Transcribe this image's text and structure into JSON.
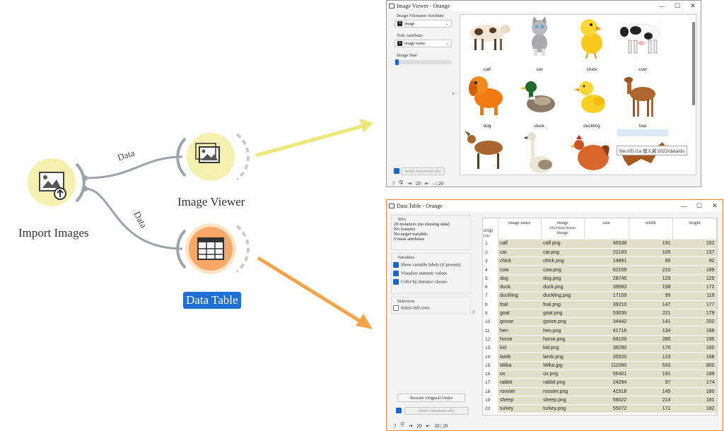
{
  "workflow": {
    "nodes": {
      "import_images": "Import Images",
      "image_viewer": "Image Viewer",
      "data_table": "Data Table"
    },
    "edges": {
      "top": "Data",
      "bottom": "Data"
    },
    "colors": {
      "node_fill": "#f4f0b0",
      "table_fill": "#f9a766",
      "edge": "#9aa4ac",
      "arrow_yellow": "#ece87a",
      "arrow_orange": "#f5a44a",
      "selected_label_bg": "#1f6fd6"
    }
  },
  "image_viewer": {
    "title": "Image Viewer - Orange",
    "filename_attr_label": "Image Filename Attribute",
    "filename_attr_value": "image",
    "title_attr_label": "Title Attribute",
    "title_attr_value": "image name",
    "size_label": "Image Size",
    "send_btn": "Send Automatically",
    "status_in": "20",
    "status_out": "- | 20",
    "tooltip": "file:///D:/1a 個人資 2022/data/do",
    "images": [
      {
        "name": "calf",
        "icon": "calf-image"
      },
      {
        "name": "cat",
        "icon": "cat-image"
      },
      {
        "name": "chick",
        "icon": "chick-image"
      },
      {
        "name": "cow",
        "icon": "cow-image"
      },
      {
        "name": "dog",
        "icon": "dog-image"
      },
      {
        "name": "duck",
        "icon": "duck-image"
      },
      {
        "name": "duckling",
        "icon": "duckling-image"
      },
      {
        "name": "foal",
        "icon": "foal-image"
      },
      {
        "name": "",
        "icon": "goat-image"
      },
      {
        "name": "",
        "icon": "goose-image"
      },
      {
        "name": "",
        "icon": "hen-image"
      },
      {
        "name": "",
        "icon": "horse-image"
      }
    ]
  },
  "data_table": {
    "title": "Data Table - Orange",
    "info_title": "Info",
    "info_lines": [
      "20 instances (no missing data)",
      "No features",
      "No target variable.",
      "5 meta attributes"
    ],
    "variables_title": "Variables",
    "opt_labels": "Show variable labels (if present)",
    "opt_numeric": "Visualize numeric values",
    "opt_color": "Color by instance classes",
    "selection_title": "Selection",
    "opt_full_rows": "Select full rows",
    "restore_btn": "Restore Original Order",
    "send_btn": "Send Automatically",
    "status_in": "20",
    "status_out": "20 | 20",
    "corner_label": "origi",
    "corner_sub": "type",
    "columns": [
      "image name",
      "image",
      "size",
      "width",
      "height"
    ],
    "image_col_sub": "2022/data/domes",
    "image_col_sub2": "image",
    "rows": [
      [
        "1",
        "calf",
        "calf.png",
        "45538",
        "191",
        "152"
      ],
      [
        "2",
        "cat",
        "cat.png",
        "22193",
        "105",
        "137"
      ],
      [
        "3",
        "chick",
        "chick.png",
        "14891",
        "85",
        "92"
      ],
      [
        "4",
        "cow",
        "cow.png",
        "62159",
        "210",
        "189"
      ],
      [
        "5",
        "dog",
        "dog.png",
        "28745",
        "129",
        "125"
      ],
      [
        "6",
        "duck",
        "duck.png",
        "39583",
        "158",
        "172"
      ],
      [
        "7",
        "duckling",
        "duckling.png",
        "17109",
        "99",
        "119"
      ],
      [
        "8",
        "foal",
        "foal.png",
        "39210",
        "147",
        "177"
      ],
      [
        "9",
        "goat",
        "goat.png",
        "53039",
        "221",
        "179"
      ],
      [
        "10",
        "goose",
        "goose.png",
        "34442",
        "141",
        "202"
      ],
      [
        "11",
        "hen",
        "hen.png",
        "41716",
        "134",
        "168"
      ],
      [
        "12",
        "horse",
        "horse.png",
        "69109",
        "285",
        "195"
      ],
      [
        "13",
        "kid",
        "kid.png",
        "36290",
        "170",
        "160"
      ],
      [
        "14",
        "lamb",
        "lamb.png",
        "35520",
        "123",
        "168"
      ],
      [
        "15",
        "Milka",
        "Milka.jpg",
        "111090",
        "533",
        "800"
      ],
      [
        "16",
        "ox",
        "ox.png",
        "56401",
        "191",
        "189"
      ],
      [
        "17",
        "rabbit",
        "rabbit.png",
        "24294",
        "97",
        "174"
      ],
      [
        "18",
        "rooster",
        "rooster.png",
        "41518",
        "145",
        "180"
      ],
      [
        "19",
        "sheep",
        "sheep.png",
        "58022",
        "214",
        "181"
      ],
      [
        "20",
        "turkey",
        "turkey.png",
        "55072",
        "171",
        "182"
      ]
    ]
  }
}
